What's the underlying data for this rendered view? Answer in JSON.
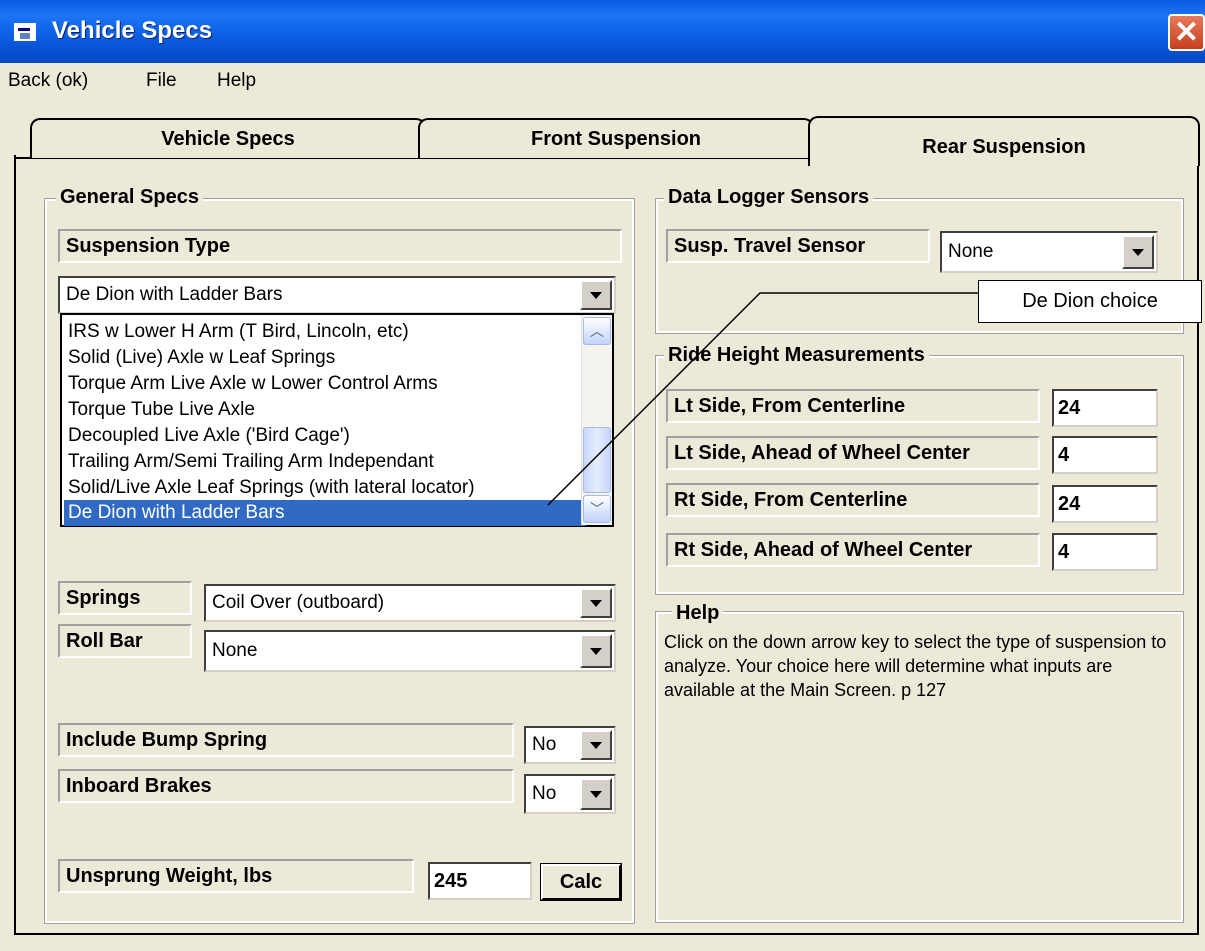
{
  "window": {
    "title": "Vehicle Specs"
  },
  "menu": {
    "items": [
      "Back (ok)",
      "File",
      "Help"
    ]
  },
  "tabs": [
    "Vehicle Specs",
    "Front Suspension",
    "Rear Suspension"
  ],
  "general_specs": {
    "title": "General Specs",
    "suspension_type_label": "Suspension Type",
    "suspension_type_value": "De Dion with Ladder Bars",
    "suspension_options": [
      "IRS w Lower H Arm (T Bird, Lincoln, etc)",
      "Solid (Live) Axle w Leaf Springs",
      "Torque Arm Live Axle w Lower Control Arms",
      "Torque Tube Live Axle",
      "Decoupled Live Axle ('Bird Cage')",
      "Trailing Arm/Semi Trailing Arm Independant",
      "Solid/Live Axle Leaf Springs (with lateral locator)",
      "De Dion with Ladder Bars"
    ],
    "springs_label": "Springs",
    "springs_value": "Coil Over (outboard)",
    "roll_bar_label": "Roll Bar",
    "roll_bar_value": "None",
    "bump_spring_label": "Include Bump Spring",
    "bump_spring_value": "No",
    "inboard_brakes_label": "Inboard Brakes",
    "inboard_brakes_value": "No",
    "unsprung_label": "Unsprung Weight, lbs",
    "unsprung_value": "245",
    "calc_button": "Calc"
  },
  "data_logger": {
    "title": "Data Logger Sensors",
    "travel_label": "Susp. Travel Sensor",
    "travel_value": "None"
  },
  "ride_height": {
    "title": "Ride Height Measurements",
    "rows": [
      {
        "label": "Lt Side, From Centerline",
        "value": "24"
      },
      {
        "label": "Lt Side, Ahead of Wheel Center",
        "value": "4"
      },
      {
        "label": "Rt Side, From Centerline",
        "value": "24"
      },
      {
        "label": "Rt Side, Ahead of Wheel Center",
        "value": "4"
      }
    ]
  },
  "help": {
    "title": "Help",
    "text": "Click on the down arrow key to select the type of suspension to analyze.  Your choice here will determine what inputs are available at the Main Screen.  p 127"
  },
  "callout": {
    "text": "De Dion choice"
  }
}
